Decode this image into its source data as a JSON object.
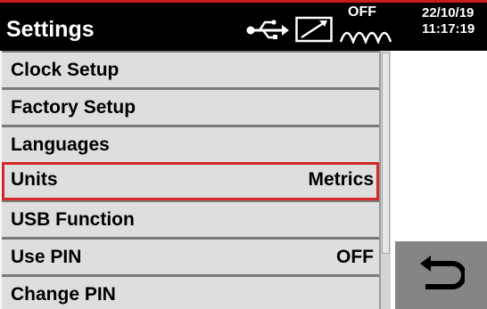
{
  "header": {
    "title": "Settings",
    "off_label": "OFF",
    "date": "22/10/19",
    "time": "11:17:19",
    "icons": [
      "usb-icon",
      "signal-icon",
      "wave-icon"
    ]
  },
  "menu": {
    "items": [
      {
        "label": "Clock Setup",
        "value": ""
      },
      {
        "label": "Factory Setup",
        "value": ""
      },
      {
        "label": "Languages",
        "value": ""
      },
      {
        "label": "Units",
        "value": "Metrics",
        "selected": true
      },
      {
        "label": "USB Function",
        "value": ""
      },
      {
        "label": "Use PIN",
        "value": "OFF"
      },
      {
        "label": "Change PIN",
        "value": ""
      }
    ]
  },
  "back_button": {
    "icon": "back-arrow-icon"
  },
  "colors": {
    "header_bg": "#000000",
    "accent_red": "#d42a2a",
    "item_bg": "#dedede",
    "button_bg": "#858585"
  }
}
